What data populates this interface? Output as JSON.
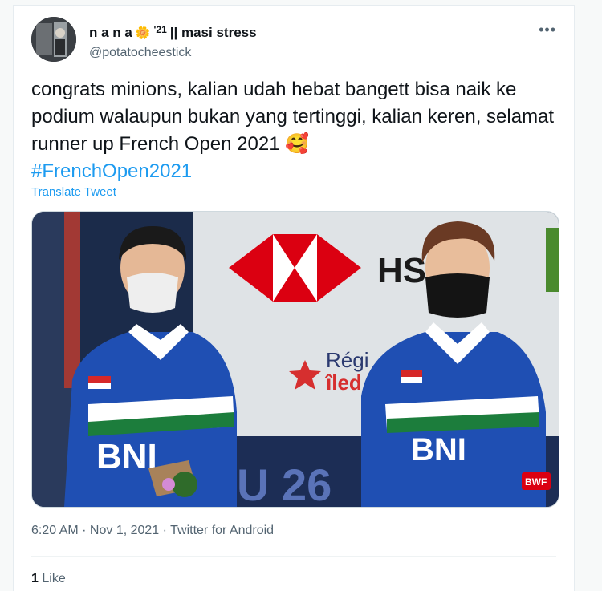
{
  "tweet": {
    "display_name": "n a n a",
    "name_emoji": "🌼",
    "name_sup": "'21",
    "name_suffix": "|| masi stress",
    "handle": "@potatocheestick",
    "more_icon": "•••",
    "text_main": "congrats minions, kalian udah hebat bangett bisa naik ke podium walaupun bukan yang tertinggi, kalian keren, selamat runner up French Open 2021",
    "text_emoji": "🥰",
    "hashtag": "#FrenchOpen2021",
    "translate_label": "Translate Tweet",
    "media": {
      "banner_text": "HS",
      "region_text_1": "Régi",
      "region_text_2": "îled",
      "jersey_text": "BNI",
      "jersey_text_2": "BNI",
      "floor_text": "U 26",
      "logo_text": "BWF"
    },
    "timestamp": "6:20 AM · Nov 1, 2021 · Twitter for Android",
    "like_count": "1",
    "like_label": "Like"
  },
  "colors": {
    "link": "#1d9bf0",
    "secondary_text": "#536471",
    "jersey_blue": "#1f4fb3",
    "jersey_green": "#1c7d3c",
    "logo_red": "#db0011"
  }
}
